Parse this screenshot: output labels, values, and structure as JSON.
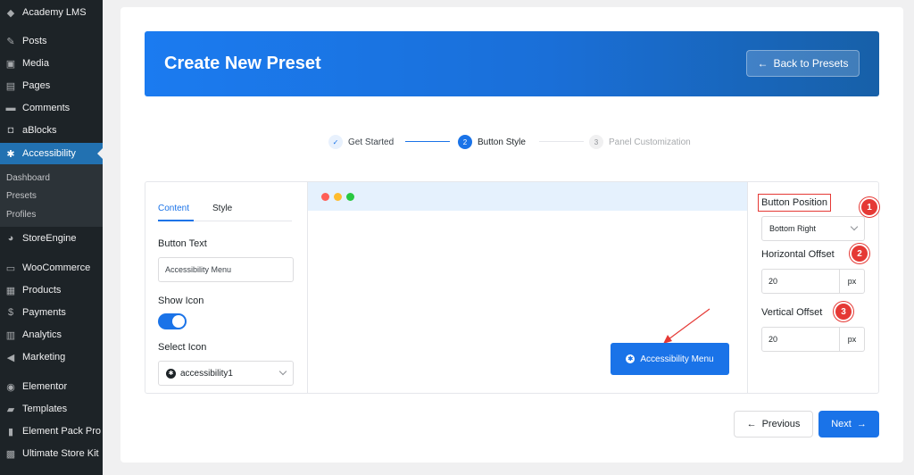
{
  "colors": {
    "sidebar": "#1d2327",
    "accent": "#2271b1",
    "primary": "#1a73e8",
    "annotation": "#e53935"
  },
  "sidebar": {
    "items": [
      {
        "label": "Academy LMS",
        "icon": "graduation-icon"
      },
      {
        "label": "Posts",
        "icon": "pin-icon"
      },
      {
        "label": "Media",
        "icon": "media-icon"
      },
      {
        "label": "Pages",
        "icon": "pages-icon"
      },
      {
        "label": "Comments",
        "icon": "comment-icon"
      },
      {
        "label": "aBlocks",
        "icon": "ablocks-icon"
      },
      {
        "label": "Accessibility",
        "icon": "accessibility-icon"
      },
      {
        "label": "StoreEngine",
        "icon": "storeengine-icon"
      },
      {
        "label": "WooCommerce",
        "icon": "woocommerce-icon"
      },
      {
        "label": "Products",
        "icon": "box-icon"
      },
      {
        "label": "Payments",
        "icon": "dollar-icon"
      },
      {
        "label": "Analytics",
        "icon": "chart-icon"
      },
      {
        "label": "Marketing",
        "icon": "megaphone-icon"
      },
      {
        "label": "Elementor",
        "icon": "elementor-icon"
      },
      {
        "label": "Templates",
        "icon": "folder-icon"
      },
      {
        "label": "Element Pack Pro",
        "icon": "elementpack-icon"
      },
      {
        "label": "Ultimate Store Kit",
        "icon": "storekit-icon"
      }
    ],
    "submenu": [
      "Dashboard",
      "Presets",
      "Profiles"
    ]
  },
  "banner": {
    "title": "Create New Preset",
    "back_label": "Back to Presets"
  },
  "stepper": {
    "steps": [
      {
        "marker": "✓",
        "label": "Get Started"
      },
      {
        "marker": "2",
        "label": "Button Style"
      },
      {
        "marker": "3",
        "label": "Panel Customization"
      }
    ]
  },
  "left_panel": {
    "tabs": [
      "Content",
      "Style"
    ],
    "button_text_label": "Button Text",
    "button_text_value": "Accessibility Menu",
    "show_icon_label": "Show Icon",
    "show_icon_on": true,
    "select_icon_label": "Select Icon",
    "select_icon_value": "accessibility1"
  },
  "preview": {
    "button_label": "Accessibility Menu"
  },
  "right_panel": {
    "position_label": "Button Position",
    "position_value": "Bottom Right",
    "h_offset_label": "Horizontal Offset",
    "h_offset_value": "20",
    "h_offset_unit": "px",
    "v_offset_label": "Vertical Offset",
    "v_offset_value": "20",
    "v_offset_unit": "px",
    "badges": [
      "1",
      "2",
      "3"
    ]
  },
  "footer": {
    "previous_label": "Previous",
    "next_label": "Next"
  }
}
